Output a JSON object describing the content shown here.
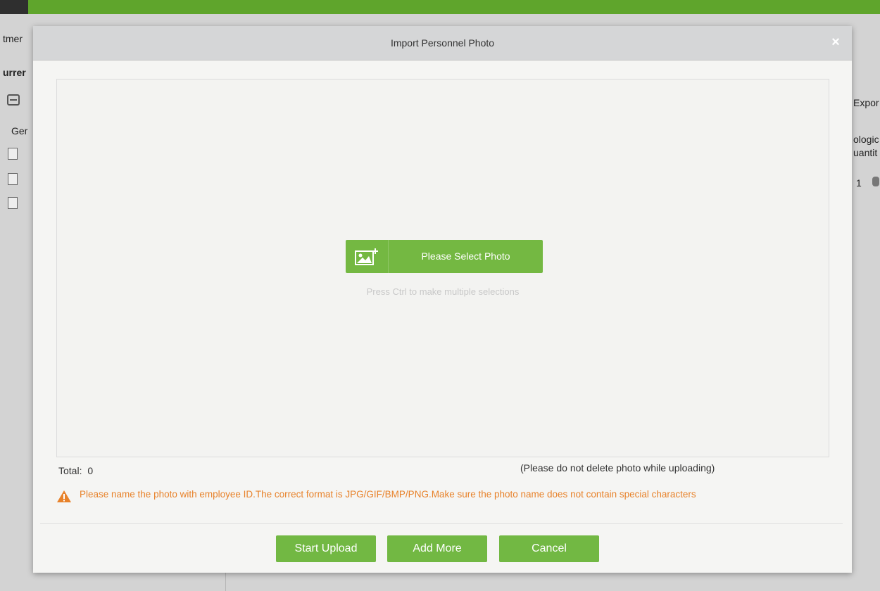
{
  "background": {
    "left_texts": [
      "tmer",
      "urrer",
      "Ger"
    ],
    "right_texts": [
      "Expor",
      "ologic",
      "uantit",
      "1"
    ]
  },
  "modal": {
    "title": "Import Personnel Photo",
    "close_symbol": "×",
    "select_button_label": "Please Select Photo",
    "select_button_icon": "image-add-icon",
    "hint": "Press Ctrl to make multiple selections",
    "total_label": "Total:",
    "total_value": "0",
    "upload_note": "(Please do not delete photo while uploading)",
    "warning": "Please name the photo with employee ID.The correct format is JPG/GIF/BMP/PNG.Make sure the photo name does not contain special characters",
    "buttons": {
      "start_upload": "Start Upload",
      "add_more": "Add More",
      "cancel": "Cancel"
    }
  },
  "colors": {
    "accent_green": "#74b842",
    "warning_orange": "#e8822a",
    "header_gray": "#d5d6d7",
    "topbar_green": "#5fa52c"
  }
}
